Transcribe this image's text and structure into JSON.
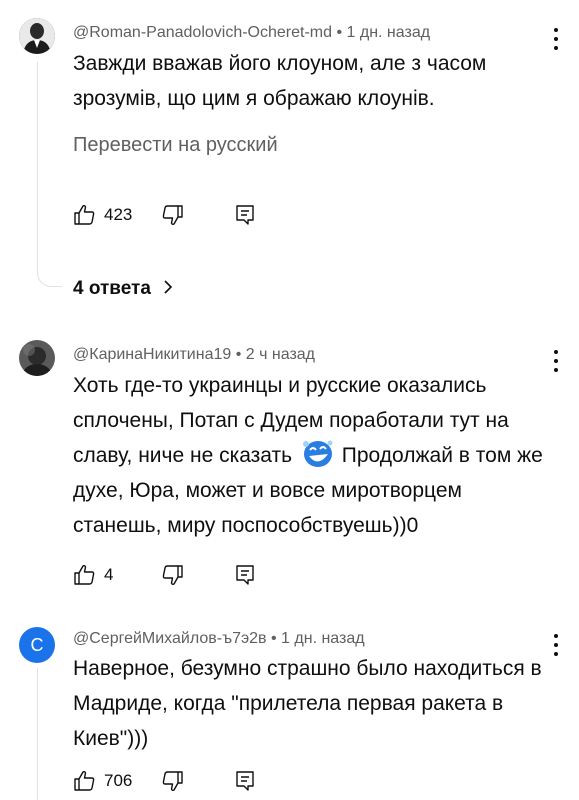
{
  "comments": [
    {
      "handle": "@Roman-Panadolovich-Ocheret-md",
      "time": "1 дн. назад",
      "text": "Завжди вважав його клоуном, але з часом зрозумів, що цим я ображаю клоунів.",
      "translate_label": "Перевести на русский",
      "likes": "423",
      "replies_label": "4 ответа"
    },
    {
      "handle": "@КаринаНикитина19",
      "time": "2 ч назад",
      "text_before_emoji": "Хоть где-то украинцы и русские оказались сплочены, Потап с Дудем поработали тут на славу, ниче не сказать",
      "text_after_emoji": "Продолжай в том же духе, Юра, может и вовсе миротворцем станешь, миру поспособствуешь))0",
      "likes": "4"
    },
    {
      "handle": "@СергейМихайлов-ъ7э2в",
      "time": "1 дн. назад",
      "avatar_letter": "С",
      "avatar_color": "#1a73e8",
      "text": "Наверное, безумно страшно было находиться в Мадриде, когда \"прилетела первая ракета в Киев\")))",
      "likes": "706"
    }
  ],
  "icons": {
    "like": "thumbs-up-icon",
    "dislike": "thumbs-down-icon",
    "reply": "reply-icon",
    "menu": "more-vertical-icon",
    "chevron": "chevron-right-icon",
    "emoji": "laughing-emoji-icon"
  }
}
